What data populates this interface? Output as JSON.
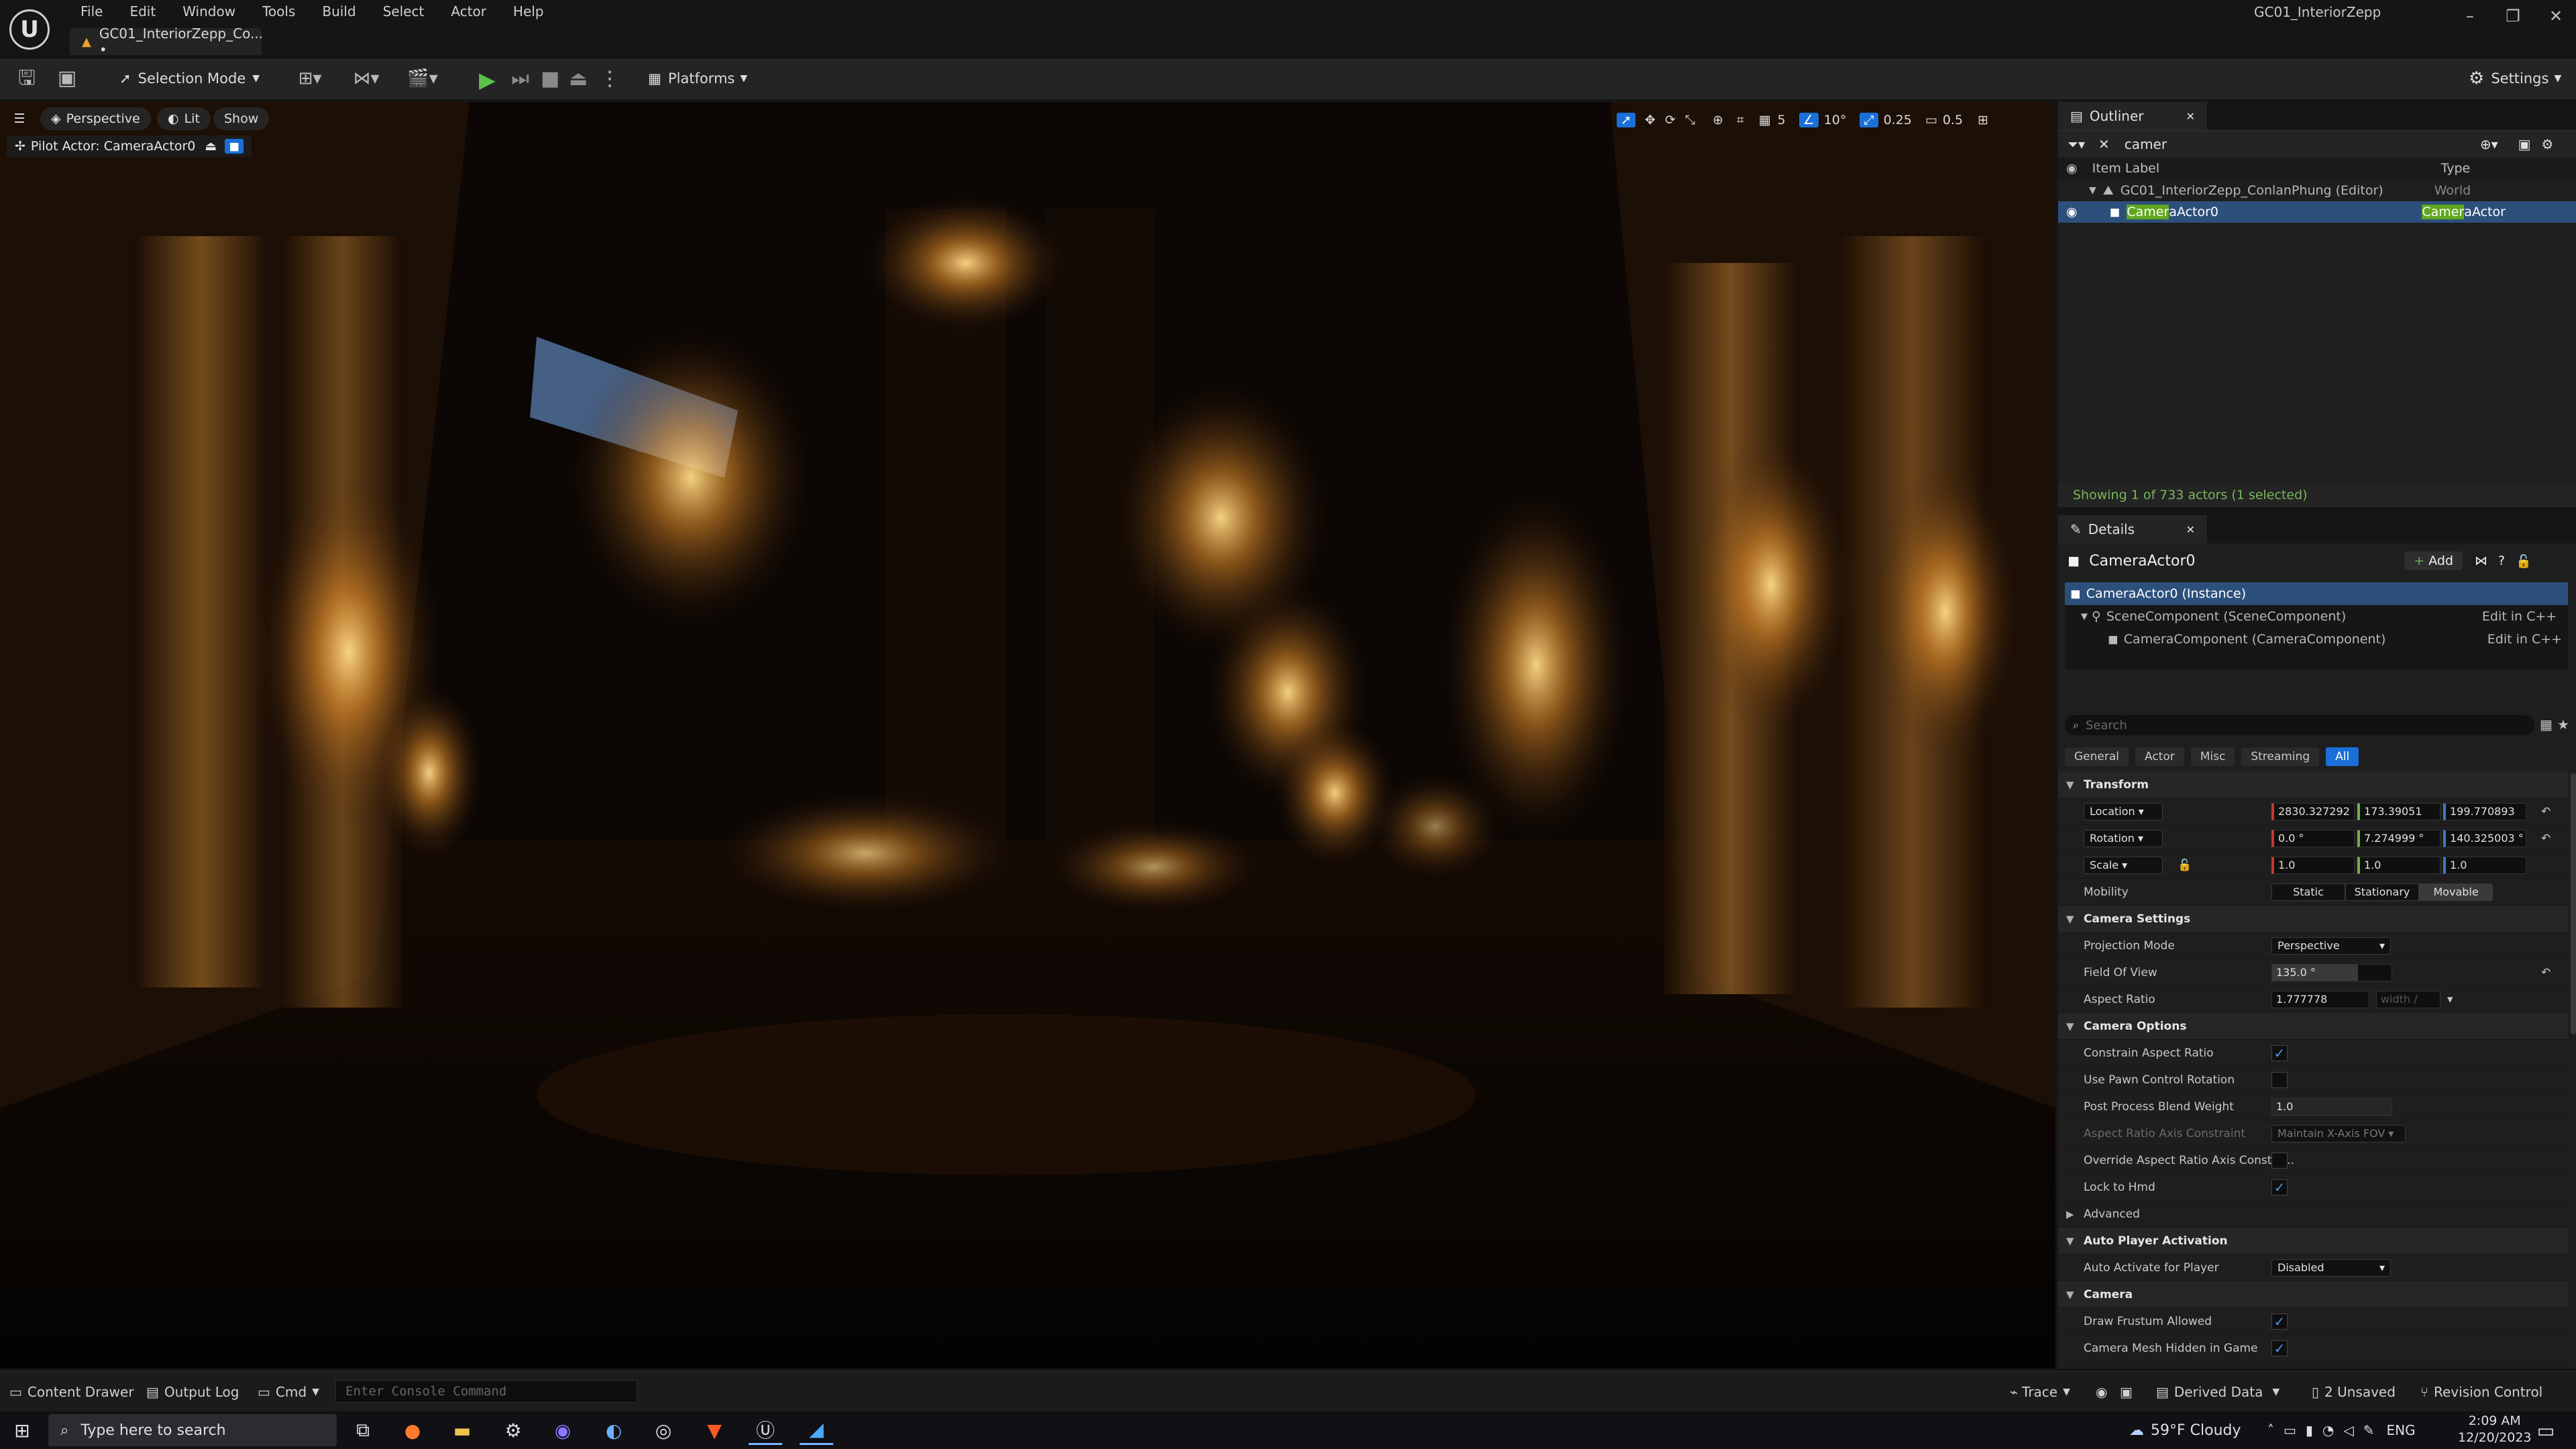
{
  "menubar": {
    "items": [
      "File",
      "Edit",
      "Window",
      "Tools",
      "Build",
      "Select",
      "Actor",
      "Help"
    ],
    "window_title": "GC01_InteriorZepp",
    "doc_tab": "GC01_InteriorZepp_Co... •"
  },
  "toolbar": {
    "selection_mode": "Selection Mode",
    "platforms": "Platforms",
    "settings": "Settings"
  },
  "viewport": {
    "perspective": "Perspective",
    "lit": "Lit",
    "show": "Show",
    "pilot_actor": "Pilot Actor: CameraActor0",
    "grid_snap": "5",
    "rotation_snap": "10°",
    "scale_snap": "0.25",
    "camera_speed": "0.5"
  },
  "outliner": {
    "tab": "Outliner",
    "search_value": "camer",
    "col_label": "Item Label",
    "col_type": "Type",
    "row_world": {
      "label": "GC01_InteriorZepp_ConlanPhung (Editor)",
      "type": "World"
    },
    "row_camera": {
      "label_hl": "Camer",
      "label_rest": "aActor0",
      "type_hl": "Camer",
      "type_rest": "aActor"
    },
    "status": "Showing 1 of 733 actors (1 selected)"
  },
  "details": {
    "tab": "Details",
    "actor_name": "CameraActor0",
    "add": "Add",
    "components": [
      {
        "label": "CameraActor0 (Instance)"
      },
      {
        "label": "SceneComponent (SceneComponent)",
        "edit": "Edit in C++"
      },
      {
        "label": "CameraComponent (CameraComponent)",
        "edit": "Edit in C++"
      }
    ],
    "search_placeholder": "Search",
    "filters": [
      "General",
      "Actor",
      "Misc",
      "Streaming",
      "All"
    ],
    "transform": {
      "title": "Transform",
      "location": "Location",
      "rotation": "Rotation",
      "scale": "Scale",
      "loc": [
        "2830.327292",
        "173.39051",
        "199.770893"
      ],
      "rot": [
        "0.0 °",
        "7.274999 °",
        "140.325003 °"
      ],
      "scl": [
        "1.0",
        "1.0",
        "1.0"
      ],
      "mobility": "Mobility",
      "mob_opts": [
        "Static",
        "Stationary",
        "Movable"
      ]
    },
    "camera_settings": {
      "title": "Camera Settings",
      "projection_mode": "Projection Mode",
      "projection_value": "Perspective",
      "fov": "Field Of View",
      "fov_value": "135.0 °",
      "aspect": "Aspect Ratio",
      "aspect_value": "1.777778",
      "aspect_hint": "width /"
    },
    "camera_options": {
      "title": "Camera Options",
      "constrain": "Constrain Aspect Ratio",
      "pawn": "Use Pawn Control Rotation",
      "ppbw": "Post Process Blend Weight",
      "ppbw_value": "1.0",
      "axis": "Aspect Ratio Axis Constraint",
      "axis_value": "Maintain X-Axis FOV",
      "override": "Override Aspect Ratio Axis Constra...",
      "lock": "Lock to Hmd",
      "advanced": "Advanced"
    },
    "auto_player": {
      "title": "Auto Player Activation",
      "auto": "Auto Activate for Player",
      "auto_value": "Disabled"
    },
    "camera": {
      "title": "Camera",
      "frustum": "Draw Frustum Allowed",
      "hidden": "Camera Mesh Hidden in Game"
    }
  },
  "bottombar": {
    "content_drawer": "Content Drawer",
    "output_log": "Output Log",
    "cmd": "Cmd",
    "console_placeholder": "Enter Console Command",
    "trace": "Trace",
    "derived": "Derived Data",
    "unsaved": "2 Unsaved",
    "revision": "Revision Control"
  },
  "taskbar": {
    "search": "Type here to search",
    "weather": "59°F  Cloudy",
    "lang": "ENG",
    "time": "2:09 AM",
    "date": "12/20/2023"
  }
}
